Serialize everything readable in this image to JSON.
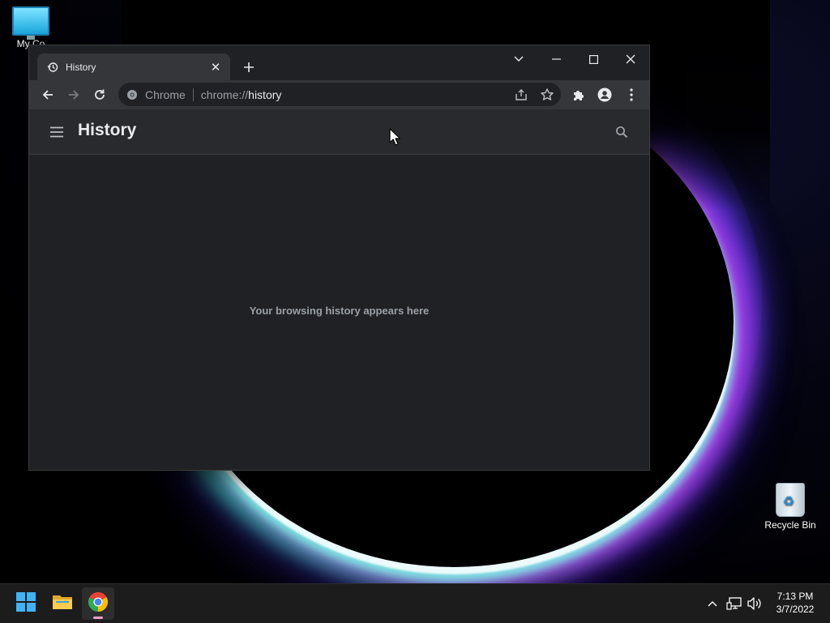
{
  "desktop": {
    "icons": [
      {
        "label": "My Co"
      },
      {
        "label": "Recycle Bin"
      }
    ]
  },
  "browser": {
    "tab": {
      "title": "History",
      "icon": "history-icon"
    },
    "omnibox": {
      "chip": "Chrome",
      "scheme": "chrome://",
      "host": "history"
    },
    "page": {
      "title": "History",
      "empty_message": "Your browsing history appears here"
    }
  },
  "taskbar": {
    "apps": [
      "start-icon",
      "file-explorer-icon",
      "chrome-icon"
    ],
    "clock": {
      "time": "7:13 PM",
      "date": "3/7/2022"
    }
  },
  "colors": {
    "window_bg": "#202124",
    "toolbar_bg": "#35363a",
    "header_bg": "#292a2d",
    "muted_text": "#9aa0a6",
    "taskbar_bg": "#1c1c1c"
  }
}
